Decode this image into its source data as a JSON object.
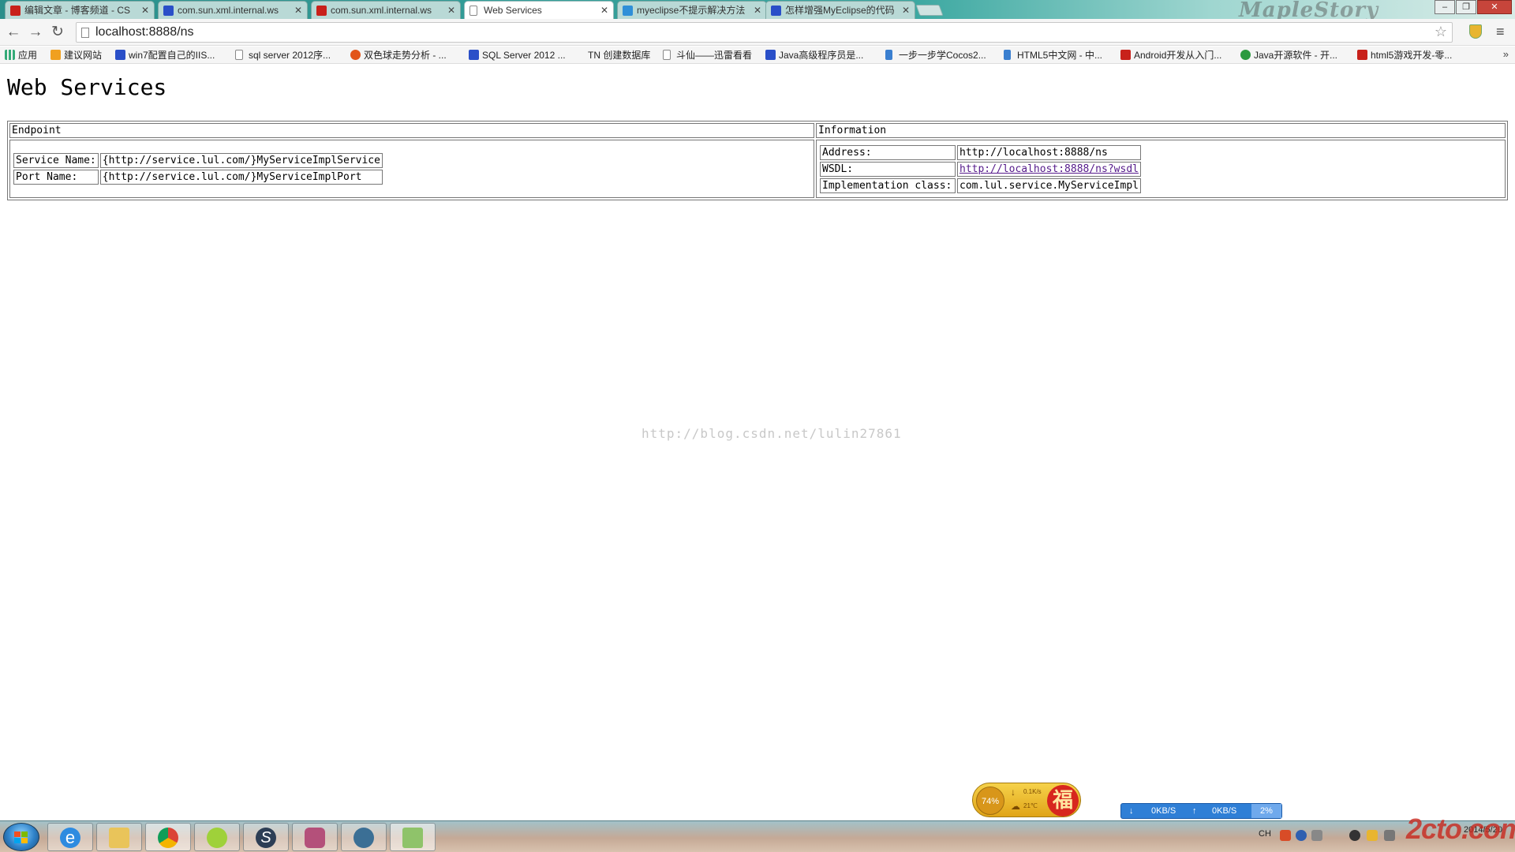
{
  "browser": {
    "tabs": [
      {
        "title": "编辑文章 - 博客频道 - CS",
        "active": false,
        "icon": "csdn-icon"
      },
      {
        "title": "com.sun.xml.internal.ws",
        "active": false,
        "icon": "baidu-paw-icon"
      },
      {
        "title": "com.sun.xml.internal.ws",
        "active": false,
        "icon": "csdn-icon"
      },
      {
        "title": "Web Services",
        "active": true,
        "icon": "page-icon"
      },
      {
        "title": "myeclipse不提示解决方法",
        "active": false,
        "icon": "baidu-zhidao-icon"
      },
      {
        "title": "怎样增强MyEclipse的代码",
        "active": false,
        "icon": "baidu-paw-icon"
      }
    ],
    "brand_watermark": "MapleStory",
    "address": "localhost:8888/ns",
    "bookmarks": [
      {
        "label": "应用",
        "icon": "apps-grid-icon"
      },
      {
        "label": "建议网站",
        "icon": "suggest-icon"
      },
      {
        "label": "win7配置自己的IIS...",
        "icon": "baidu-paw-icon"
      },
      {
        "label": "sql server 2012序...",
        "icon": "page-icon"
      },
      {
        "label": "双色球走势分析 - ...",
        "icon": "orange-circle-icon"
      },
      {
        "label": "SQL Server 2012 ...",
        "icon": "baidu-paw-icon"
      },
      {
        "label": "TN 创建数据库",
        "icon": "none"
      },
      {
        "label": "斗仙——迅雷看看",
        "icon": "page-icon"
      },
      {
        "label": "Java高级程序员是...",
        "icon": "baidu-paw-icon"
      },
      {
        "label": "一步一步学Cocos2...",
        "icon": "html5-icon"
      },
      {
        "label": "HTML5中文网 - 中...",
        "icon": "html5-icon"
      },
      {
        "label": "Android开发从入门...",
        "icon": "csdn-icon"
      },
      {
        "label": "Java开源软件 - 开...",
        "icon": "oschina-icon"
      },
      {
        "label": "html5游戏开发-零...",
        "icon": "csdn-icon"
      }
    ],
    "bookmarks_overflow": "»"
  },
  "page": {
    "heading": "Web Services",
    "table": {
      "headers": [
        "Endpoint",
        "Information"
      ],
      "endpoint": {
        "service_label": "Service Name:",
        "service_value": "{http://service.lul.com/}MyServiceImplService",
        "port_label": "Port Name:",
        "port_value": "{http://service.lul.com/}MyServiceImplPort"
      },
      "information": {
        "address_label": "Address:",
        "address_value": "http://localhost:8888/ns",
        "wsdl_label": "WSDL:",
        "wsdl_value": "http://localhost:8888/ns?wsdl",
        "impl_label": "Implementation class:",
        "impl_value": "com.lul.service.MyServiceImpl"
      }
    },
    "watermark": "http://blog.csdn.net/lulin27861"
  },
  "widgets": {
    "weather": {
      "percent": "74%",
      "speed": "0.1K/s",
      "temp": "21℃",
      "fu": "福"
    },
    "netspeed": {
      "down": "0KB/S",
      "up": "0KB/S",
      "cpu": "2%"
    }
  },
  "taskbar": {
    "apps": [
      "internet-explorer",
      "file-explorer",
      "chrome",
      "lime-app",
      "sql-app",
      "database-app",
      "settings-app",
      "editor-app"
    ],
    "tray_lang": "CH",
    "clock_date": "2014/5/20",
    "corner_logo": "2cto.com"
  }
}
